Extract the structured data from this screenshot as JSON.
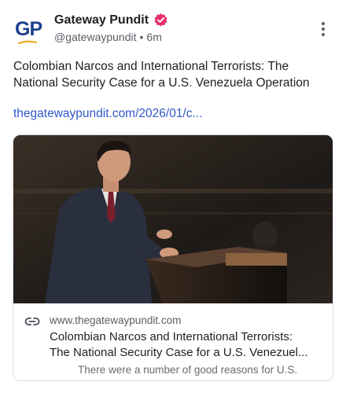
{
  "account": {
    "avatar_text": "GP",
    "display_name": "Gateway Pundit",
    "handle": "@gatewaypundit",
    "separator": "•",
    "time_ago": "6m",
    "verified": true
  },
  "post": {
    "text": "Colombian Narcos and International Terrorists: The National Security Case for a U.S. Venezuela Operation",
    "link_text": "thegatewaypundit.com/2026/01/c..."
  },
  "link_card": {
    "domain": "www.thegatewaypundit.com",
    "title_line1": "Colombian Narcos and International Terrorists:",
    "title_line2": "The National Security Case for a U.S. Venezuel...",
    "description": "There were a number of good reasons for U.S."
  },
  "icons": {
    "verified": "verified-badge-icon",
    "more": "more-options-icon",
    "link": "link-icon"
  },
  "colors": {
    "brand_blue": "#1d3f8f",
    "link": "#2f58c9",
    "verified": "#e1306c",
    "text": "#1f1f24",
    "muted": "#5c5c66"
  }
}
